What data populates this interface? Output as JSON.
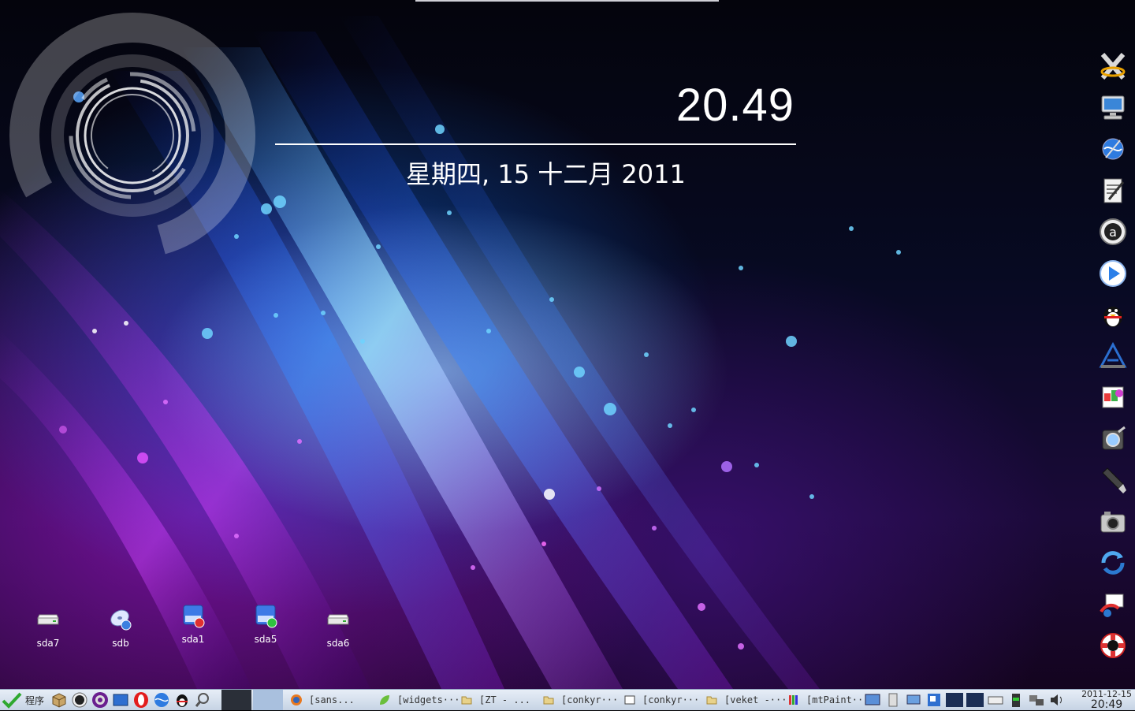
{
  "clock": {
    "time": "20.49",
    "date": "星期四, 15 十二月 2011"
  },
  "desktop_icons": [
    {
      "label": "sda7",
      "icon": "drive-icon"
    },
    {
      "label": "sdb",
      "icon": "usb-disc-icon"
    },
    {
      "label": "sda1",
      "icon": "drive-mounted-red-icon"
    },
    {
      "label": "sda5",
      "icon": "drive-mounted-green-icon"
    },
    {
      "label": "sda6",
      "icon": "drive-icon"
    }
  ],
  "dock_icons": [
    "xorg-icon",
    "computer-icon",
    "browser-globe-icon",
    "text-editor-icon",
    "amule-icon",
    "media-player-icon",
    "qq-penguin-icon",
    "abiword-icon",
    "gnumeric-icon",
    "screenshot-icon",
    "usb-stick-icon",
    "camera-icon",
    "update-icon",
    "network-icon",
    "help-lifebuoy-icon"
  ],
  "taskbar": {
    "start_label": "程序",
    "tasks": [
      {
        "label": "[sans...",
        "icon": "firefox-icon"
      },
      {
        "label": "[widgets···",
        "icon": "leaf-icon"
      },
      {
        "label": "[ZT - ...",
        "icon": "folder-icon"
      },
      {
        "label": "[conkyr···",
        "icon": "folder-icon"
      },
      {
        "label": "[conkyr···",
        "icon": "terminal-icon"
      },
      {
        "label": "[veket -···",
        "icon": "folder-icon"
      },
      {
        "label": "[mtPaint···",
        "icon": "mtpaint-icon"
      }
    ],
    "tray_date": "2011-12-15",
    "tray_time": "20:49"
  },
  "colors": {
    "accent": "#ffffff",
    "taskbar_top": "#e7eef7",
    "taskbar_bottom": "#c6d3e4"
  }
}
